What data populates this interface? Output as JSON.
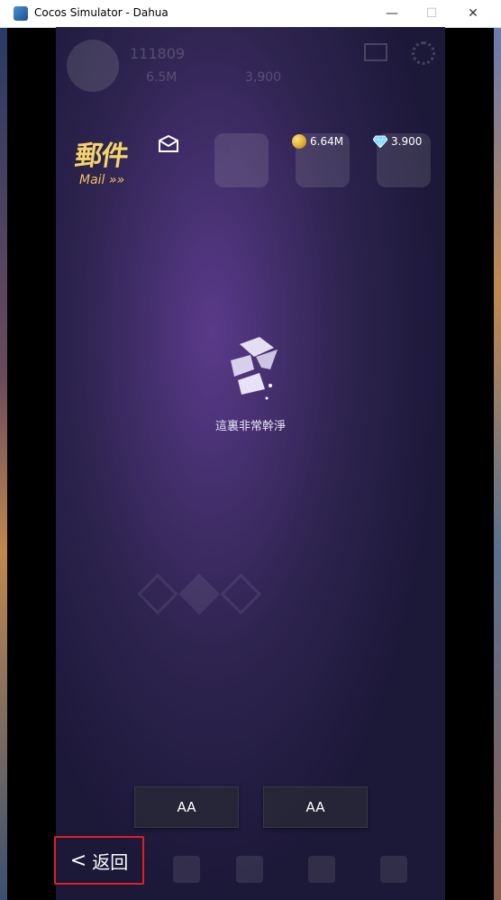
{
  "window": {
    "title": "Cocos Simulator - Dahua",
    "minimize": "—",
    "maximize": "☐",
    "close": "✕"
  },
  "hud": {
    "player_id": "111809",
    "coins": "6.5M",
    "gems": "3,900"
  },
  "mail": {
    "title": "郵件",
    "subtitle": "Mail"
  },
  "currency": {
    "coins": "6.64M",
    "gems": "3.900"
  },
  "empty_state": {
    "label": "這裏非常幹淨"
  },
  "buttons": {
    "left": "AA",
    "right": "AA"
  },
  "back": {
    "label": "返回"
  },
  "colors": {
    "accent": "#f5d56a",
    "back_border": "#e02020"
  }
}
